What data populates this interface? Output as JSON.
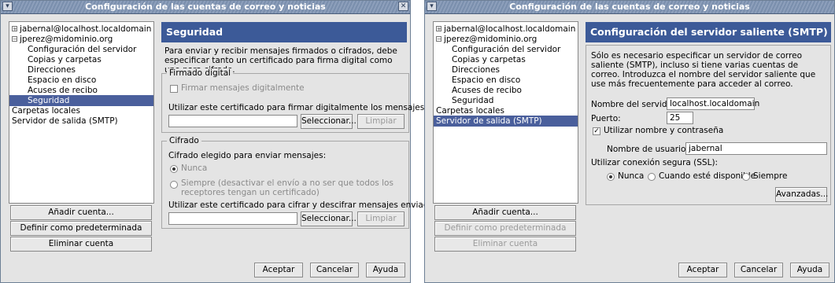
{
  "left_window": {
    "title": "Configuración de las cuentas de correo y noticias",
    "tree": [
      {
        "label": "jabernal@localhost.localdomain",
        "expander": "+",
        "selected": false
      },
      {
        "label": "jperez@midominio.org",
        "expander": "−",
        "selected": false
      },
      {
        "label": "Configuración del servidor",
        "selected": false
      },
      {
        "label": "Copias y carpetas",
        "selected": false
      },
      {
        "label": "Direcciones",
        "selected": false
      },
      {
        "label": "Espacio en disco",
        "selected": false
      },
      {
        "label": "Acuses de recibo",
        "selected": false
      },
      {
        "label": "Seguridad",
        "selected": true
      },
      {
        "label": "Carpetas locales",
        "selected": false
      },
      {
        "label": "Servidor de salida (SMTP)",
        "selected": false
      }
    ],
    "buttons": {
      "add_account": "Añadir cuenta...",
      "set_default": "Definir como predeterminada",
      "delete_account": "Eliminar cuenta"
    },
    "panel": {
      "title": "Seguridad",
      "intro": "Para enviar y recibir mensajes firmados o cifrados, debe especificar tanto un certificado para firma digital como uno para cifrado.",
      "digital_signing": {
        "legend": "Firmado digital",
        "sign_checkbox": "Firmar mensajes digitalmente",
        "cert_label": "Utilizar este certificado para firmar digitalmente los mensajes que envíe:",
        "select_btn": "Seleccionar...",
        "clear_btn": "Limpiar"
      },
      "encryption": {
        "legend": "Cifrado",
        "choose_label": "Cifrado elegido para enviar mensajes:",
        "never": "Nunca",
        "always": "Siempre (desactivar el envío a no ser que todos los receptores tengan un certificado)",
        "cert_label": "Utilizar este certificado para cifrar y descifrar mensajes enviados a Vd.:",
        "select_btn": "Seleccionar...",
        "clear_btn": "Limpiar"
      }
    },
    "footer": {
      "accept": "Aceptar",
      "cancel": "Cancelar",
      "help": "Ayuda"
    }
  },
  "right_window": {
    "title": "Configuración de las cuentas de correo y noticias",
    "tree": [
      {
        "label": "jabernal@localhost.localdomain",
        "expander": "+",
        "selected": false
      },
      {
        "label": "jperez@midominio.org",
        "expander": "−",
        "selected": false
      },
      {
        "label": "Configuración del servidor",
        "selected": false
      },
      {
        "label": "Copias y carpetas",
        "selected": false
      },
      {
        "label": "Direcciones",
        "selected": false
      },
      {
        "label": "Espacio en disco",
        "selected": false
      },
      {
        "label": "Acuses de recibo",
        "selected": false
      },
      {
        "label": "Seguridad",
        "selected": false
      },
      {
        "label": "Carpetas locales",
        "selected": false
      },
      {
        "label": "Servidor de salida (SMTP)",
        "selected": true
      }
    ],
    "buttons": {
      "add_account": "Añadir cuenta...",
      "set_default": "Definir como predeterminada",
      "delete_account": "Eliminar cuenta"
    },
    "panel": {
      "title": "Configuración del servidor saliente (SMTP)",
      "intro": "Sólo es necesario especificar un servidor de correo saliente (SMTP), incluso si tiene varias cuentas de correo. Introduzca el nombre del servidor saliente que use más frecuentemente para acceder al correo.",
      "server_label": "Nombre del servidor:",
      "server_value": "localhost.localdomain",
      "port_label": "Puerto:",
      "port_value": "25",
      "use_auth": "Utilizar nombre y contraseña",
      "username_label": "Nombre de usuario:",
      "username_value": "jabernal",
      "ssl_label": "Utilizar conexión segura (SSL):",
      "ssl_never": "Nunca",
      "ssl_when_available": "Cuando esté disponible",
      "ssl_always": "Siempre",
      "advanced_btn": "Avanzadas..."
    },
    "footer": {
      "accept": "Aceptar",
      "cancel": "Cancelar",
      "help": "Ayuda"
    }
  }
}
